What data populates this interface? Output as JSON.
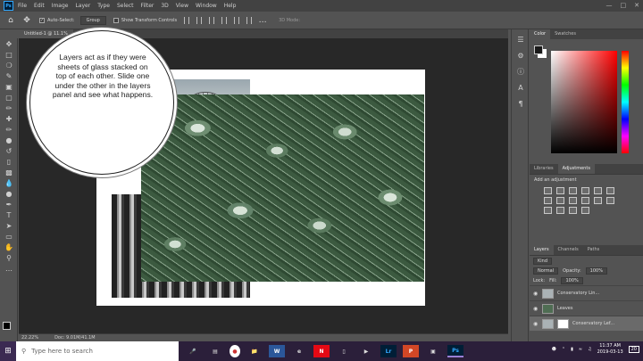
{
  "menubar": {
    "logo": "Ps",
    "items": [
      "File",
      "Edit",
      "Image",
      "Layer",
      "Type",
      "Select",
      "Filter",
      "3D",
      "View",
      "Window",
      "Help"
    ]
  },
  "options": {
    "auto_select_label": "Auto-Select:",
    "auto_select_value": "Group",
    "transform_label": "Show Transform Controls",
    "mode_3d": "3D Mode:"
  },
  "document": {
    "tab_title": "Untitled-1 @ 11.1%"
  },
  "callout": {
    "text": "Layers act as if they were sheets of glass stacked on top of each other. Slide one under the other in the layers panel and see what happens."
  },
  "status": {
    "zoom": "22.22%",
    "doc_size": "Doc: 9.01M/41.1M"
  },
  "panels": {
    "color_tabs": [
      "Color",
      "Swatches"
    ],
    "adj_tabs": [
      "Libraries",
      "Adjustments"
    ],
    "adj_label": "Add an adjustment",
    "layer_tabs": [
      "Layers",
      "Channels",
      "Paths"
    ],
    "kind_label": "Kind",
    "blend_mode": "Normal",
    "opacity_label": "Opacity:",
    "opacity_value": "100%",
    "lock_label": "Lock:",
    "fill_label": "Fill:",
    "fill_value": "100%",
    "layers": [
      {
        "name": "Conservatory Lin..."
      },
      {
        "name": "Leaves"
      },
      {
        "name": "Conservatory Lef..."
      }
    ]
  },
  "taskbar": {
    "search_placeholder": "Type here to search",
    "apps": [
      "W",
      "N",
      "Lr",
      "Ps"
    ],
    "time": "11:37 AM",
    "date": "2019-03-13",
    "notification_count": "20"
  }
}
